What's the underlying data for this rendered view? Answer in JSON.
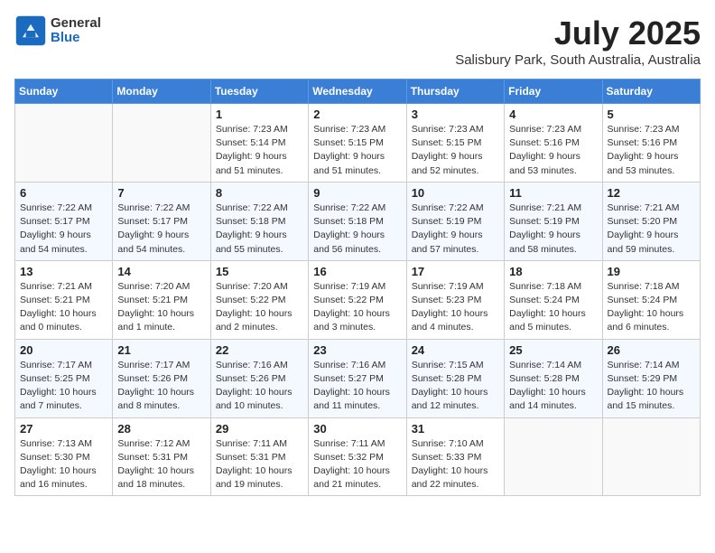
{
  "header": {
    "logo_general": "General",
    "logo_blue": "Blue",
    "month_title": "July 2025",
    "location": "Salisbury Park, South Australia, Australia"
  },
  "calendar": {
    "days_of_week": [
      "Sunday",
      "Monday",
      "Tuesday",
      "Wednesday",
      "Thursday",
      "Friday",
      "Saturday"
    ],
    "weeks": [
      [
        {
          "day": "",
          "info": ""
        },
        {
          "day": "",
          "info": ""
        },
        {
          "day": "1",
          "info": "Sunrise: 7:23 AM\nSunset: 5:14 PM\nDaylight: 9 hours and 51 minutes."
        },
        {
          "day": "2",
          "info": "Sunrise: 7:23 AM\nSunset: 5:15 PM\nDaylight: 9 hours and 51 minutes."
        },
        {
          "day": "3",
          "info": "Sunrise: 7:23 AM\nSunset: 5:15 PM\nDaylight: 9 hours and 52 minutes."
        },
        {
          "day": "4",
          "info": "Sunrise: 7:23 AM\nSunset: 5:16 PM\nDaylight: 9 hours and 53 minutes."
        },
        {
          "day": "5",
          "info": "Sunrise: 7:23 AM\nSunset: 5:16 PM\nDaylight: 9 hours and 53 minutes."
        }
      ],
      [
        {
          "day": "6",
          "info": "Sunrise: 7:22 AM\nSunset: 5:17 PM\nDaylight: 9 hours and 54 minutes."
        },
        {
          "day": "7",
          "info": "Sunrise: 7:22 AM\nSunset: 5:17 PM\nDaylight: 9 hours and 54 minutes."
        },
        {
          "day": "8",
          "info": "Sunrise: 7:22 AM\nSunset: 5:18 PM\nDaylight: 9 hours and 55 minutes."
        },
        {
          "day": "9",
          "info": "Sunrise: 7:22 AM\nSunset: 5:18 PM\nDaylight: 9 hours and 56 minutes."
        },
        {
          "day": "10",
          "info": "Sunrise: 7:22 AM\nSunset: 5:19 PM\nDaylight: 9 hours and 57 minutes."
        },
        {
          "day": "11",
          "info": "Sunrise: 7:21 AM\nSunset: 5:19 PM\nDaylight: 9 hours and 58 minutes."
        },
        {
          "day": "12",
          "info": "Sunrise: 7:21 AM\nSunset: 5:20 PM\nDaylight: 9 hours and 59 minutes."
        }
      ],
      [
        {
          "day": "13",
          "info": "Sunrise: 7:21 AM\nSunset: 5:21 PM\nDaylight: 10 hours and 0 minutes."
        },
        {
          "day": "14",
          "info": "Sunrise: 7:20 AM\nSunset: 5:21 PM\nDaylight: 10 hours and 1 minute."
        },
        {
          "day": "15",
          "info": "Sunrise: 7:20 AM\nSunset: 5:22 PM\nDaylight: 10 hours and 2 minutes."
        },
        {
          "day": "16",
          "info": "Sunrise: 7:19 AM\nSunset: 5:22 PM\nDaylight: 10 hours and 3 minutes."
        },
        {
          "day": "17",
          "info": "Sunrise: 7:19 AM\nSunset: 5:23 PM\nDaylight: 10 hours and 4 minutes."
        },
        {
          "day": "18",
          "info": "Sunrise: 7:18 AM\nSunset: 5:24 PM\nDaylight: 10 hours and 5 minutes."
        },
        {
          "day": "19",
          "info": "Sunrise: 7:18 AM\nSunset: 5:24 PM\nDaylight: 10 hours and 6 minutes."
        }
      ],
      [
        {
          "day": "20",
          "info": "Sunrise: 7:17 AM\nSunset: 5:25 PM\nDaylight: 10 hours and 7 minutes."
        },
        {
          "day": "21",
          "info": "Sunrise: 7:17 AM\nSunset: 5:26 PM\nDaylight: 10 hours and 8 minutes."
        },
        {
          "day": "22",
          "info": "Sunrise: 7:16 AM\nSunset: 5:26 PM\nDaylight: 10 hours and 10 minutes."
        },
        {
          "day": "23",
          "info": "Sunrise: 7:16 AM\nSunset: 5:27 PM\nDaylight: 10 hours and 11 minutes."
        },
        {
          "day": "24",
          "info": "Sunrise: 7:15 AM\nSunset: 5:28 PM\nDaylight: 10 hours and 12 minutes."
        },
        {
          "day": "25",
          "info": "Sunrise: 7:14 AM\nSunset: 5:28 PM\nDaylight: 10 hours and 14 minutes."
        },
        {
          "day": "26",
          "info": "Sunrise: 7:14 AM\nSunset: 5:29 PM\nDaylight: 10 hours and 15 minutes."
        }
      ],
      [
        {
          "day": "27",
          "info": "Sunrise: 7:13 AM\nSunset: 5:30 PM\nDaylight: 10 hours and 16 minutes."
        },
        {
          "day": "28",
          "info": "Sunrise: 7:12 AM\nSunset: 5:31 PM\nDaylight: 10 hours and 18 minutes."
        },
        {
          "day": "29",
          "info": "Sunrise: 7:11 AM\nSunset: 5:31 PM\nDaylight: 10 hours and 19 minutes."
        },
        {
          "day": "30",
          "info": "Sunrise: 7:11 AM\nSunset: 5:32 PM\nDaylight: 10 hours and 21 minutes."
        },
        {
          "day": "31",
          "info": "Sunrise: 7:10 AM\nSunset: 5:33 PM\nDaylight: 10 hours and 22 minutes."
        },
        {
          "day": "",
          "info": ""
        },
        {
          "day": "",
          "info": ""
        }
      ]
    ]
  }
}
